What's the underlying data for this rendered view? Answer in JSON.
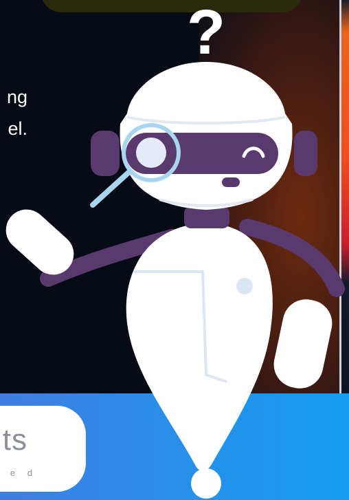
{
  "body_text": {
    "line1": "ng",
    "line2": "el."
  },
  "logo": {
    "word": "ts",
    "tagline": "e d"
  },
  "illustration": {
    "question_mark": "?"
  },
  "colors": {
    "background": "#070b16",
    "accent_orange": "#f04d1e",
    "band_blue": "#149cf0",
    "robot_purple": "#5a3a6e",
    "robot_white": "#ffffff",
    "lens_ring": "#a8d6f0"
  }
}
